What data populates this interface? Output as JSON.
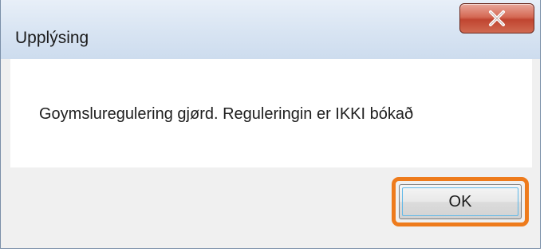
{
  "dialog": {
    "title": "Upplýsing",
    "message": "Goymsluregulering gjørd. Reguleringin er IKKI bókað",
    "ok_label": "OK",
    "close_icon": "close-icon",
    "close_color": "#c7462f",
    "highlight_color": "#ee7b1c"
  }
}
